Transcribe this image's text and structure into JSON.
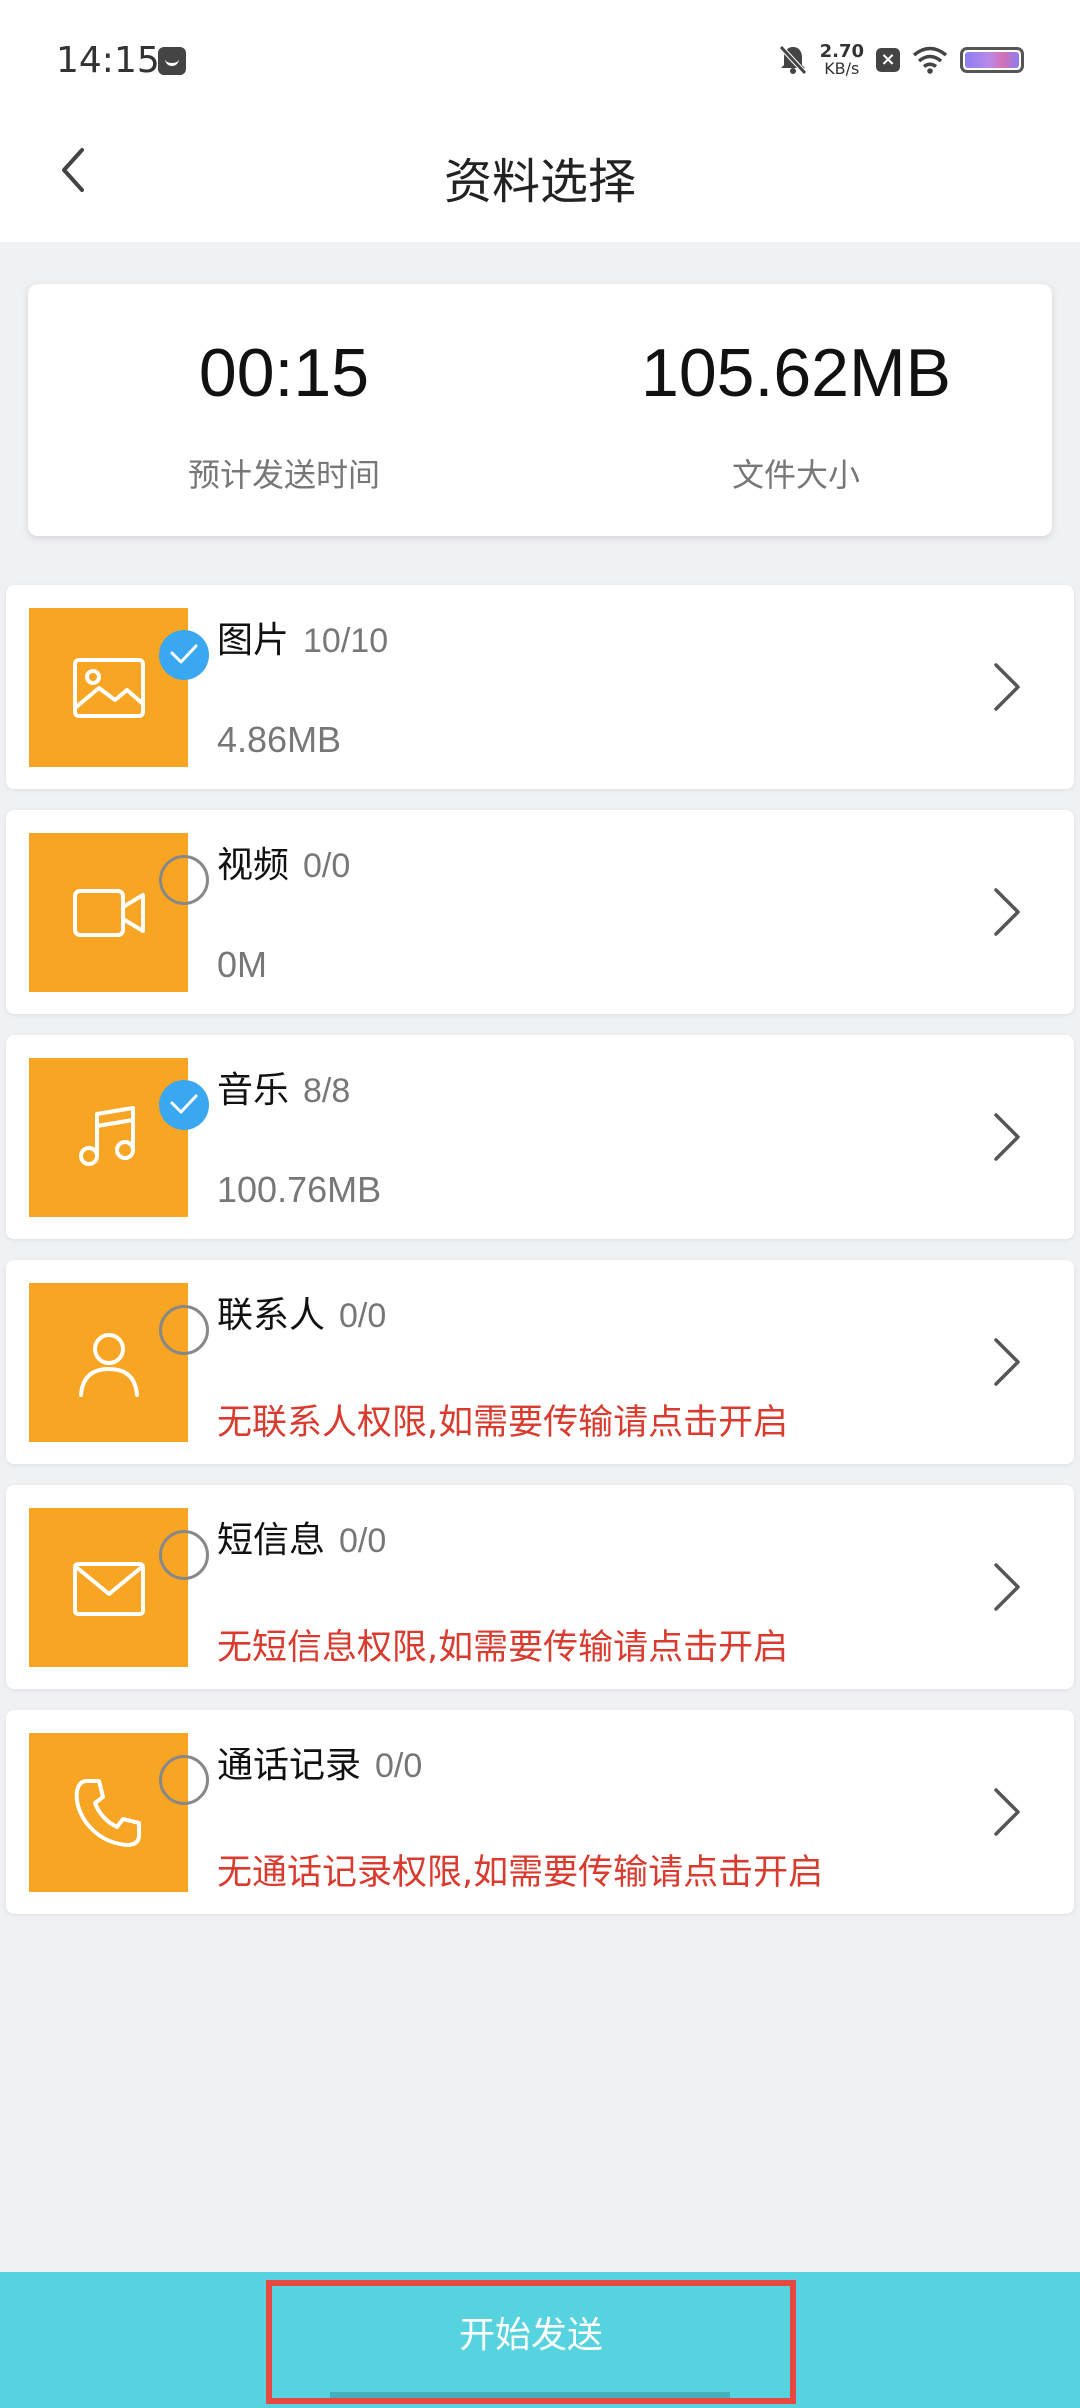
{
  "status_bar": {
    "time": "14:15",
    "net_speed_value": "2.70",
    "net_speed_unit": "KB/s",
    "icons": [
      "message-app-icon",
      "bell-muted-icon",
      "close-box-icon",
      "wifi-icon",
      "battery-icon"
    ]
  },
  "header": {
    "title": "资料选择",
    "back_icon": "chevron-left-icon"
  },
  "summary": {
    "time_value": "00:15",
    "time_label": "预计发送时间",
    "size_value": "105.62MB",
    "size_label": "文件大小"
  },
  "categories": [
    {
      "name": "图片",
      "count": "10/10",
      "size": "4.86MB",
      "warning": "",
      "checked": true,
      "icon": "image-icon"
    },
    {
      "name": "视频",
      "count": "0/0",
      "size": "0M",
      "warning": "",
      "checked": false,
      "icon": "video-camera-icon"
    },
    {
      "name": "音乐",
      "count": "8/8",
      "size": "100.76MB",
      "warning": "",
      "checked": true,
      "icon": "music-note-icon"
    },
    {
      "name": "联系人",
      "count": "0/0",
      "size": "",
      "warning": "无联系人权限,如需要传输请点击开启",
      "checked": false,
      "icon": "person-icon"
    },
    {
      "name": "短信息",
      "count": "0/0",
      "size": "",
      "warning": "无短信息权限,如需要传输请点击开启",
      "checked": false,
      "icon": "envelope-icon"
    },
    {
      "name": "通话记录",
      "count": "0/0",
      "size": "",
      "warning": "无通话记录权限,如需要传输请点击开启",
      "checked": false,
      "icon": "phone-icon"
    }
  ],
  "footer": {
    "start_label": "开始发送"
  },
  "colors": {
    "thumb_bg": "#f8a524",
    "checked": "#3aa8f0",
    "warning": "#d93b2f",
    "bottom_bar": "#56d3df",
    "highlight_border": "#e5493f"
  }
}
